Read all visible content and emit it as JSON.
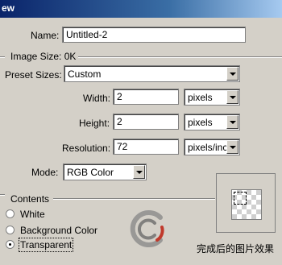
{
  "window": {
    "title_fragment": "ew"
  },
  "name_field": {
    "label": "Name:",
    "value": "Untitled-2"
  },
  "image_size": {
    "label": "Image Size: 0K"
  },
  "preset": {
    "label": "Preset Sizes:",
    "value": "Custom"
  },
  "width": {
    "label": "Width:",
    "value": "2",
    "unit": "pixels"
  },
  "height": {
    "label": "Height:",
    "value": "2",
    "unit": "pixels"
  },
  "resolution": {
    "label": "Resolution:",
    "value": "72",
    "unit": "pixels/inch"
  },
  "mode": {
    "label": "Mode:",
    "value": "RGB Color"
  },
  "contents": {
    "label": "Contents",
    "options": [
      {
        "label": "White",
        "selected": false
      },
      {
        "label": "Background Color",
        "selected": false
      },
      {
        "label": "Transparent",
        "selected": true
      }
    ]
  },
  "preview": {
    "caption": "完成后的图片效果"
  }
}
